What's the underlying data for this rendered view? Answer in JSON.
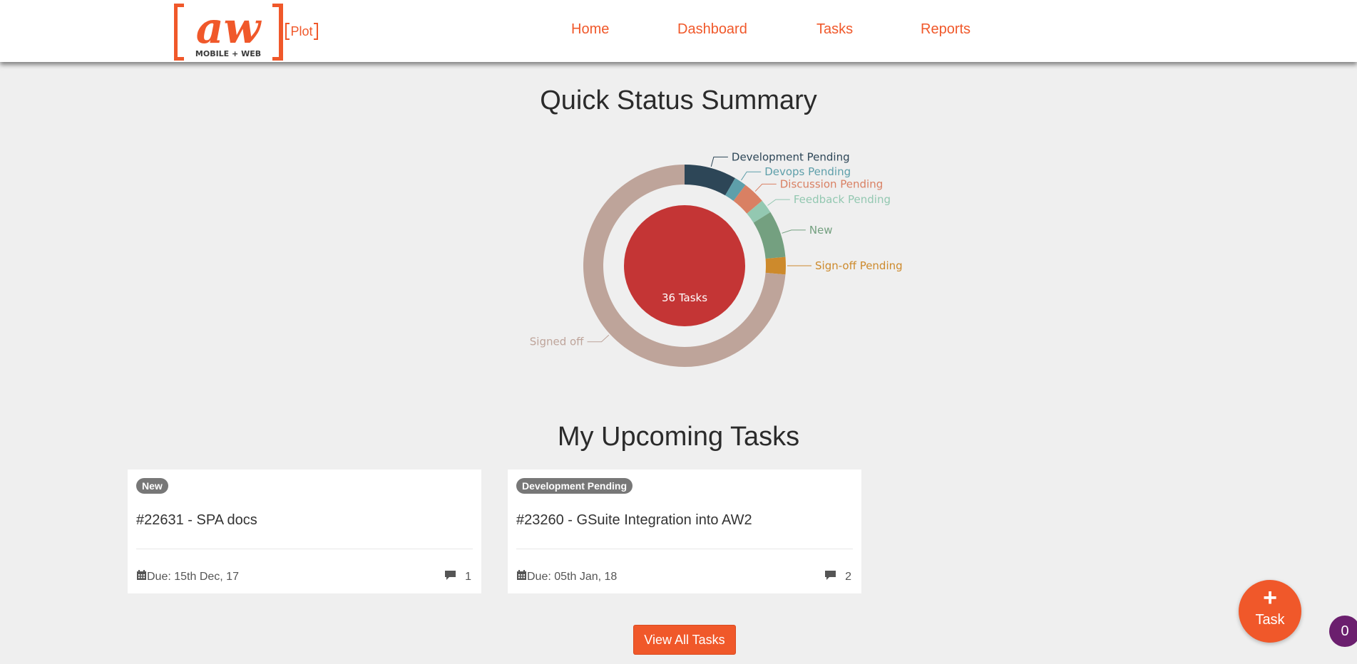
{
  "logo": {
    "main": "aw",
    "sub": "MOBILE + WEB",
    "tag": "Plot"
  },
  "nav": [
    {
      "label": "Home"
    },
    {
      "label": "Dashboard"
    },
    {
      "label": "Tasks"
    },
    {
      "label": "Reports"
    }
  ],
  "summary": {
    "title": "Quick Status Summary"
  },
  "colors": {
    "accent": "#f0582a",
    "badge": "#777777",
    "counter": "#6b1f6e"
  },
  "chart_data": {
    "type": "pie",
    "center_label": "36 Tasks",
    "center_color": "#c43535",
    "slices": [
      {
        "label": "Development Pending",
        "value": 3,
        "color": "#2d4657"
      },
      {
        "label": "Devops Pending",
        "value": 0.7,
        "color": "#5e9faa"
      },
      {
        "label": "Discussion Pending",
        "value": 1.3,
        "color": "#d98063"
      },
      {
        "label": "Feedback Pending",
        "value": 0.8,
        "color": "#93c8b1"
      },
      {
        "label": "New",
        "value": 2.7,
        "color": "#74a080"
      },
      {
        "label": "Sign-off Pending",
        "value": 1,
        "color": "#cd8a2c"
      },
      {
        "label": "Signed off",
        "value": 26.5,
        "color": "#bea49a"
      }
    ]
  },
  "upcoming": {
    "title": "My Upcoming Tasks",
    "tasks": [
      {
        "badge": "New",
        "title": "#22631 - SPA docs",
        "due": "Due: 15th Dec, 17",
        "comments": "1"
      },
      {
        "badge": "Development Pending",
        "title": "#23260 - GSuite Integration into AW2",
        "due": "Due: 05th Jan, 18",
        "comments": "2"
      }
    ],
    "view_all_label": "View All Tasks"
  },
  "fab": {
    "label": "Task",
    "icon": "plus-icon"
  },
  "counter": {
    "value": "0"
  }
}
